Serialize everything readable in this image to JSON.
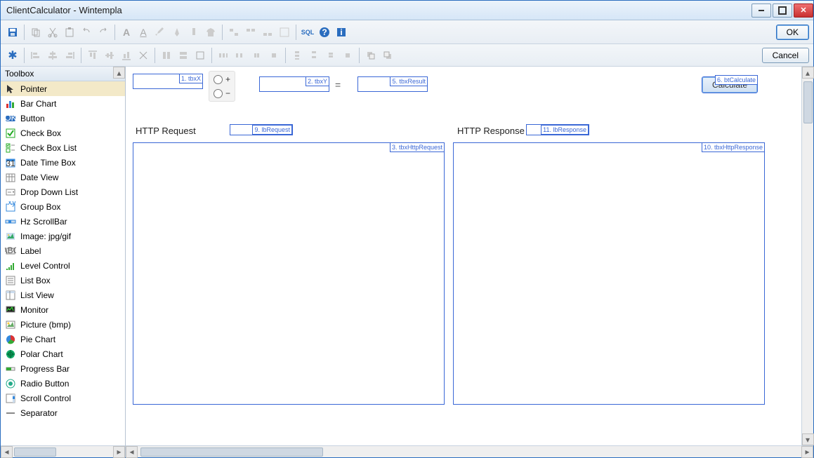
{
  "window": {
    "title": "ClientCalculator  -  Wintempla"
  },
  "dialog": {
    "ok": "OK",
    "cancel": "Cancel"
  },
  "toolbox": {
    "header": "Toolbox",
    "items": [
      {
        "label": "Pointer",
        "icon": "pointer"
      },
      {
        "label": "Bar Chart",
        "icon": "barchart"
      },
      {
        "label": "Button",
        "icon": "button"
      },
      {
        "label": "Check Box",
        "icon": "checkbox"
      },
      {
        "label": "Check Box List",
        "icon": "checkboxlist"
      },
      {
        "label": "Date Time Box",
        "icon": "datetime"
      },
      {
        "label": "Date View",
        "icon": "dateview"
      },
      {
        "label": "Drop Down List",
        "icon": "dropdown"
      },
      {
        "label": "Group Box",
        "icon": "groupbox"
      },
      {
        "label": "Hz ScrollBar",
        "icon": "hscroll"
      },
      {
        "label": "Image: jpg/gif",
        "icon": "image"
      },
      {
        "label": "Label",
        "icon": "label"
      },
      {
        "label": "Level Control",
        "icon": "level"
      },
      {
        "label": "List Box",
        "icon": "listbox"
      },
      {
        "label": "List View",
        "icon": "listview"
      },
      {
        "label": "Monitor",
        "icon": "monitor"
      },
      {
        "label": "Picture (bmp)",
        "icon": "picture"
      },
      {
        "label": "Pie Chart",
        "icon": "piechart"
      },
      {
        "label": "Polar Chart",
        "icon": "polar"
      },
      {
        "label": "Progress Bar",
        "icon": "progress"
      },
      {
        "label": "Radio Button",
        "icon": "radio"
      },
      {
        "label": "Scroll Control",
        "icon": "scrollctl"
      },
      {
        "label": "Separator",
        "icon": "separator"
      }
    ],
    "selected_index": 0
  },
  "canvas": {
    "tbxX": {
      "tag": "1. tbxX"
    },
    "tbxY": {
      "tag": "2. tbxY"
    },
    "tbxResult": {
      "tag": "5. tbxResult"
    },
    "radio_plus": "+",
    "radio_minus": "−",
    "equals": "=",
    "btCalculate": {
      "tag": "6. btCalculate",
      "text": "Calculate"
    },
    "lblRequest": {
      "text": "HTTP Request",
      "tag": "9. lbRequest"
    },
    "lblResponse": {
      "text": "HTTP Response",
      "tag": "11. lbResponse"
    },
    "tbxHttpRequest": {
      "tag": "3. tbxHttpRequest"
    },
    "tbxHttpResponse": {
      "tag": "10. tbxHttpResponse"
    }
  }
}
